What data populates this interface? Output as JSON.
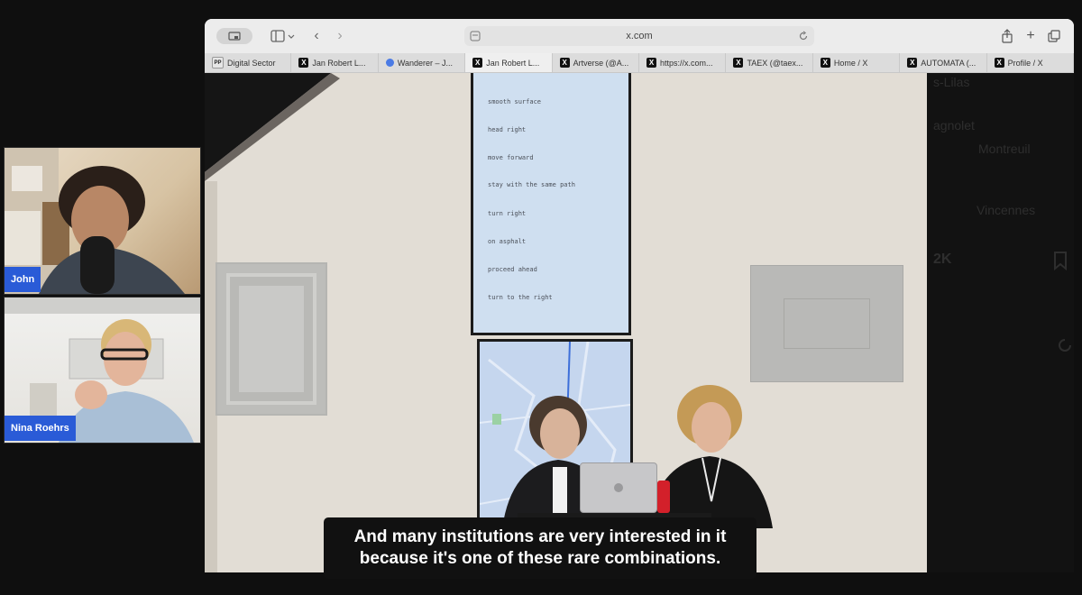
{
  "participants": [
    {
      "name": "John"
    },
    {
      "name": "Nina Roehrs"
    }
  ],
  "browser": {
    "address": "x.com",
    "tabs": [
      {
        "label": "Digital Sector",
        "icon": "pp",
        "active": false
      },
      {
        "label": "Jan Robert L...",
        "icon": "x",
        "active": false
      },
      {
        "label": "Wanderer – J...",
        "icon": "dot",
        "active": false
      },
      {
        "label": "Jan Robert L...",
        "icon": "x",
        "active": true
      },
      {
        "label": "Artverse (@A...",
        "icon": "x",
        "active": false
      },
      {
        "label": "https://x.com...",
        "icon": "x",
        "active": false
      },
      {
        "label": "TAEX (@taex...",
        "icon": "x",
        "active": false
      },
      {
        "label": "Home / X",
        "icon": "x",
        "active": false
      },
      {
        "label": "AUTOMATA (...",
        "icon": "x",
        "active": false
      },
      {
        "label": "Profile / X",
        "icon": "x",
        "active": false
      }
    ]
  },
  "video": {
    "screen_lines": [
      "smooth surface",
      "head right",
      "move forward",
      "stay with the same path",
      "turn right",
      "on asphalt",
      "proceed ahead",
      "turn to the right"
    ],
    "side_labels": [
      "s-Lilas",
      "agnolet",
      "Montreuil",
      "Vincennes",
      "2K"
    ]
  },
  "subtitle": {
    "line1": "And many institutions are very interested in it",
    "line2": "because it's one of these rare combinations."
  },
  "colors": {
    "name_tag": "#2a5bd7",
    "background": "#0f0f0f",
    "toolbar": "#ececec"
  }
}
